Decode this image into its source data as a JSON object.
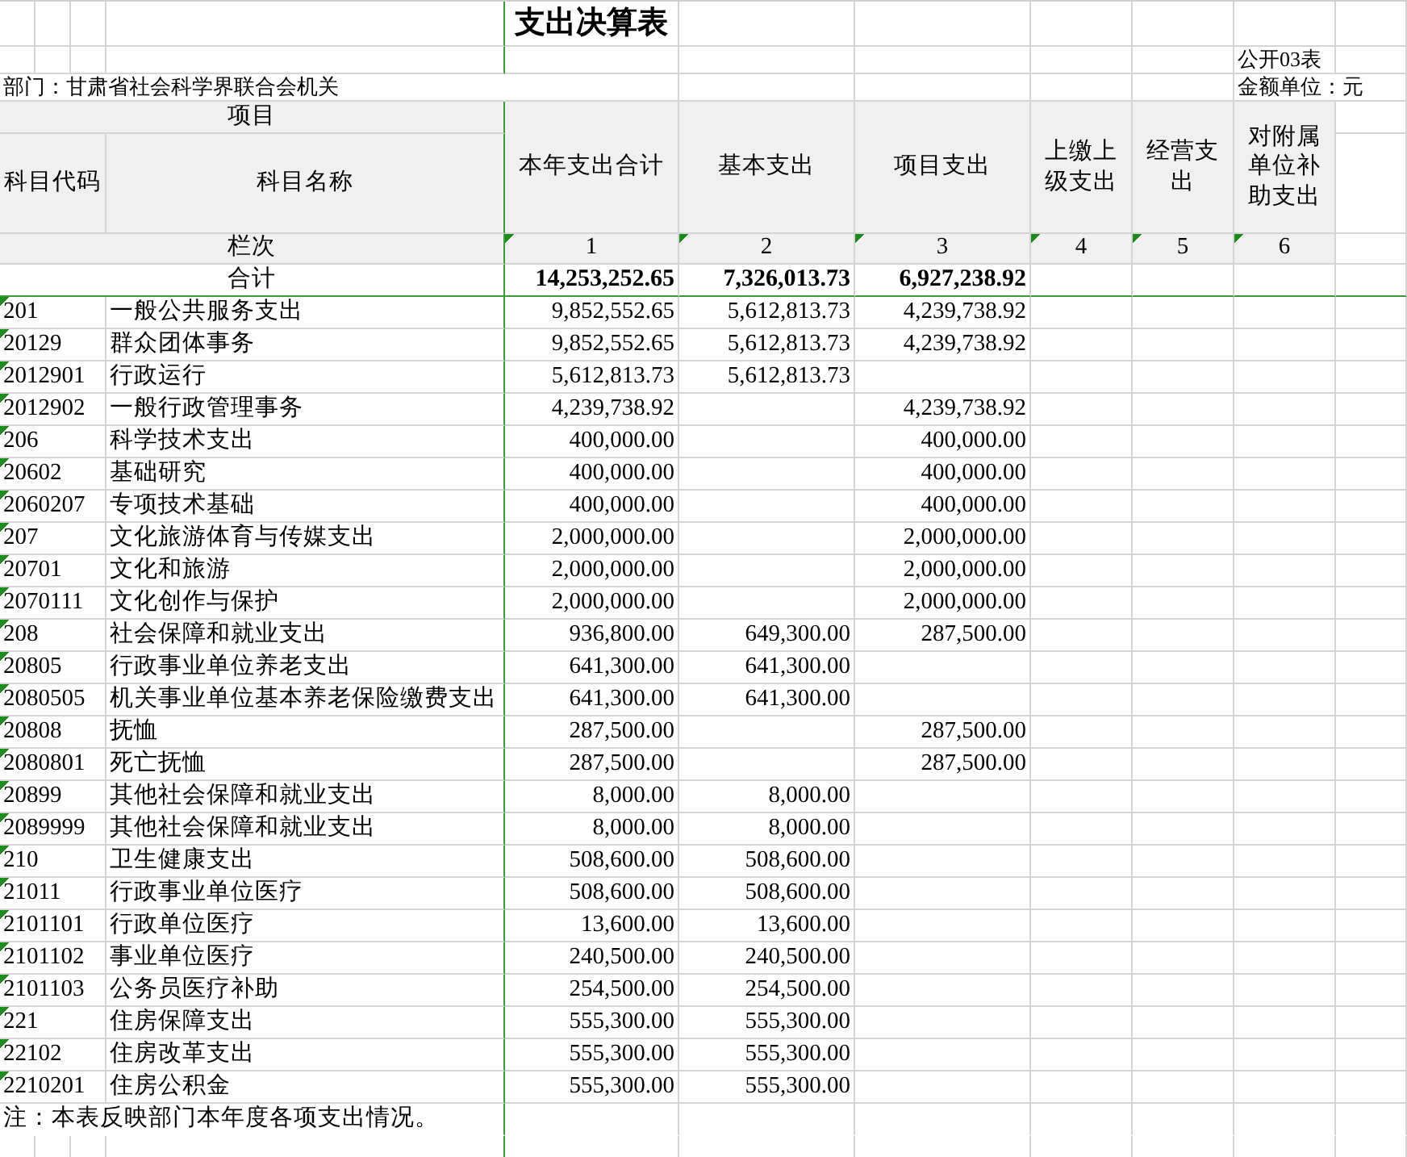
{
  "title": "支出决算表",
  "table_no": "公开03表",
  "department": "部门：甘肃省社会科学界联合会机关",
  "unit": "金额单位：元",
  "header": {
    "item_group": "项目",
    "code": "科目代码",
    "name": "科目名称",
    "columns": [
      "本年支出合计",
      "基本支出",
      "项目支出",
      "上缴上级支出",
      "经营支出",
      "对附属单位补助支出"
    ]
  },
  "index_row": {
    "label": "栏次",
    "numbers": [
      "1",
      "2",
      "3",
      "4",
      "5",
      "6"
    ]
  },
  "total": {
    "label": "合计",
    "total": "14,253,252.65",
    "basic": "7,326,013.73",
    "project": "6,927,238.92"
  },
  "rows": [
    {
      "code": "201",
      "name": "一般公共服务支出",
      "total": "9,852,552.65",
      "basic": "5,612,813.73",
      "project": "4,239,738.92"
    },
    {
      "code": "20129",
      "name": "群众团体事务",
      "total": "9,852,552.65",
      "basic": "5,612,813.73",
      "project": "4,239,738.92"
    },
    {
      "code": "2012901",
      "name": "行政运行",
      "total": "5,612,813.73",
      "basic": "5,612,813.73"
    },
    {
      "code": "2012902",
      "name": "一般行政管理事务",
      "total": "4,239,738.92",
      "project": "4,239,738.92"
    },
    {
      "code": "206",
      "name": "科学技术支出",
      "total": "400,000.00",
      "project": "400,000.00"
    },
    {
      "code": "20602",
      "name": "基础研究",
      "total": "400,000.00",
      "project": "400,000.00"
    },
    {
      "code": "2060207",
      "name": "专项技术基础",
      "total": "400,000.00",
      "project": "400,000.00"
    },
    {
      "code": "207",
      "name": "文化旅游体育与传媒支出",
      "total": "2,000,000.00",
      "project": "2,000,000.00"
    },
    {
      "code": "20701",
      "name": "文化和旅游",
      "total": "2,000,000.00",
      "project": "2,000,000.00"
    },
    {
      "code": "2070111",
      "name": "文化创作与保护",
      "total": "2,000,000.00",
      "project": "2,000,000.00"
    },
    {
      "code": "208",
      "name": "社会保障和就业支出",
      "total": "936,800.00",
      "basic": "649,300.00",
      "project": "287,500.00"
    },
    {
      "code": "20805",
      "name": "行政事业单位养老支出",
      "total": "641,300.00",
      "basic": "641,300.00"
    },
    {
      "code": "2080505",
      "name": "机关事业单位基本养老保险缴费支出",
      "total": "641,300.00",
      "basic": "641,300.00"
    },
    {
      "code": "20808",
      "name": "抚恤",
      "total": "287,500.00",
      "project": "287,500.00"
    },
    {
      "code": "2080801",
      "name": "死亡抚恤",
      "total": "287,500.00",
      "project": "287,500.00"
    },
    {
      "code": "20899",
      "name": "其他社会保障和就业支出",
      "total": "8,000.00",
      "basic": "8,000.00"
    },
    {
      "code": "2089999",
      "name": "其他社会保障和就业支出",
      "total": "8,000.00",
      "basic": "8,000.00"
    },
    {
      "code": "210",
      "name": "卫生健康支出",
      "total": "508,600.00",
      "basic": "508,600.00"
    },
    {
      "code": "21011",
      "name": "行政事业单位医疗",
      "total": "508,600.00",
      "basic": "508,600.00"
    },
    {
      "code": "2101101",
      "name": "行政单位医疗",
      "total": "13,600.00",
      "basic": "13,600.00"
    },
    {
      "code": "2101102",
      "name": "事业单位医疗",
      "total": "240,500.00",
      "basic": "240,500.00"
    },
    {
      "code": "2101103",
      "name": "公务员医疗补助",
      "total": "254,500.00",
      "basic": "254,500.00"
    },
    {
      "code": "221",
      "name": "住房保障支出",
      "total": "555,300.00",
      "basic": "555,300.00"
    },
    {
      "code": "22102",
      "name": "住房改革支出",
      "total": "555,300.00",
      "basic": "555,300.00"
    },
    {
      "code": "2210201",
      "name": "住房公积金",
      "total": "555,300.00",
      "basic": "555,300.00"
    }
  ],
  "note": "注：本表反映部门本年度各项支出情况。"
}
